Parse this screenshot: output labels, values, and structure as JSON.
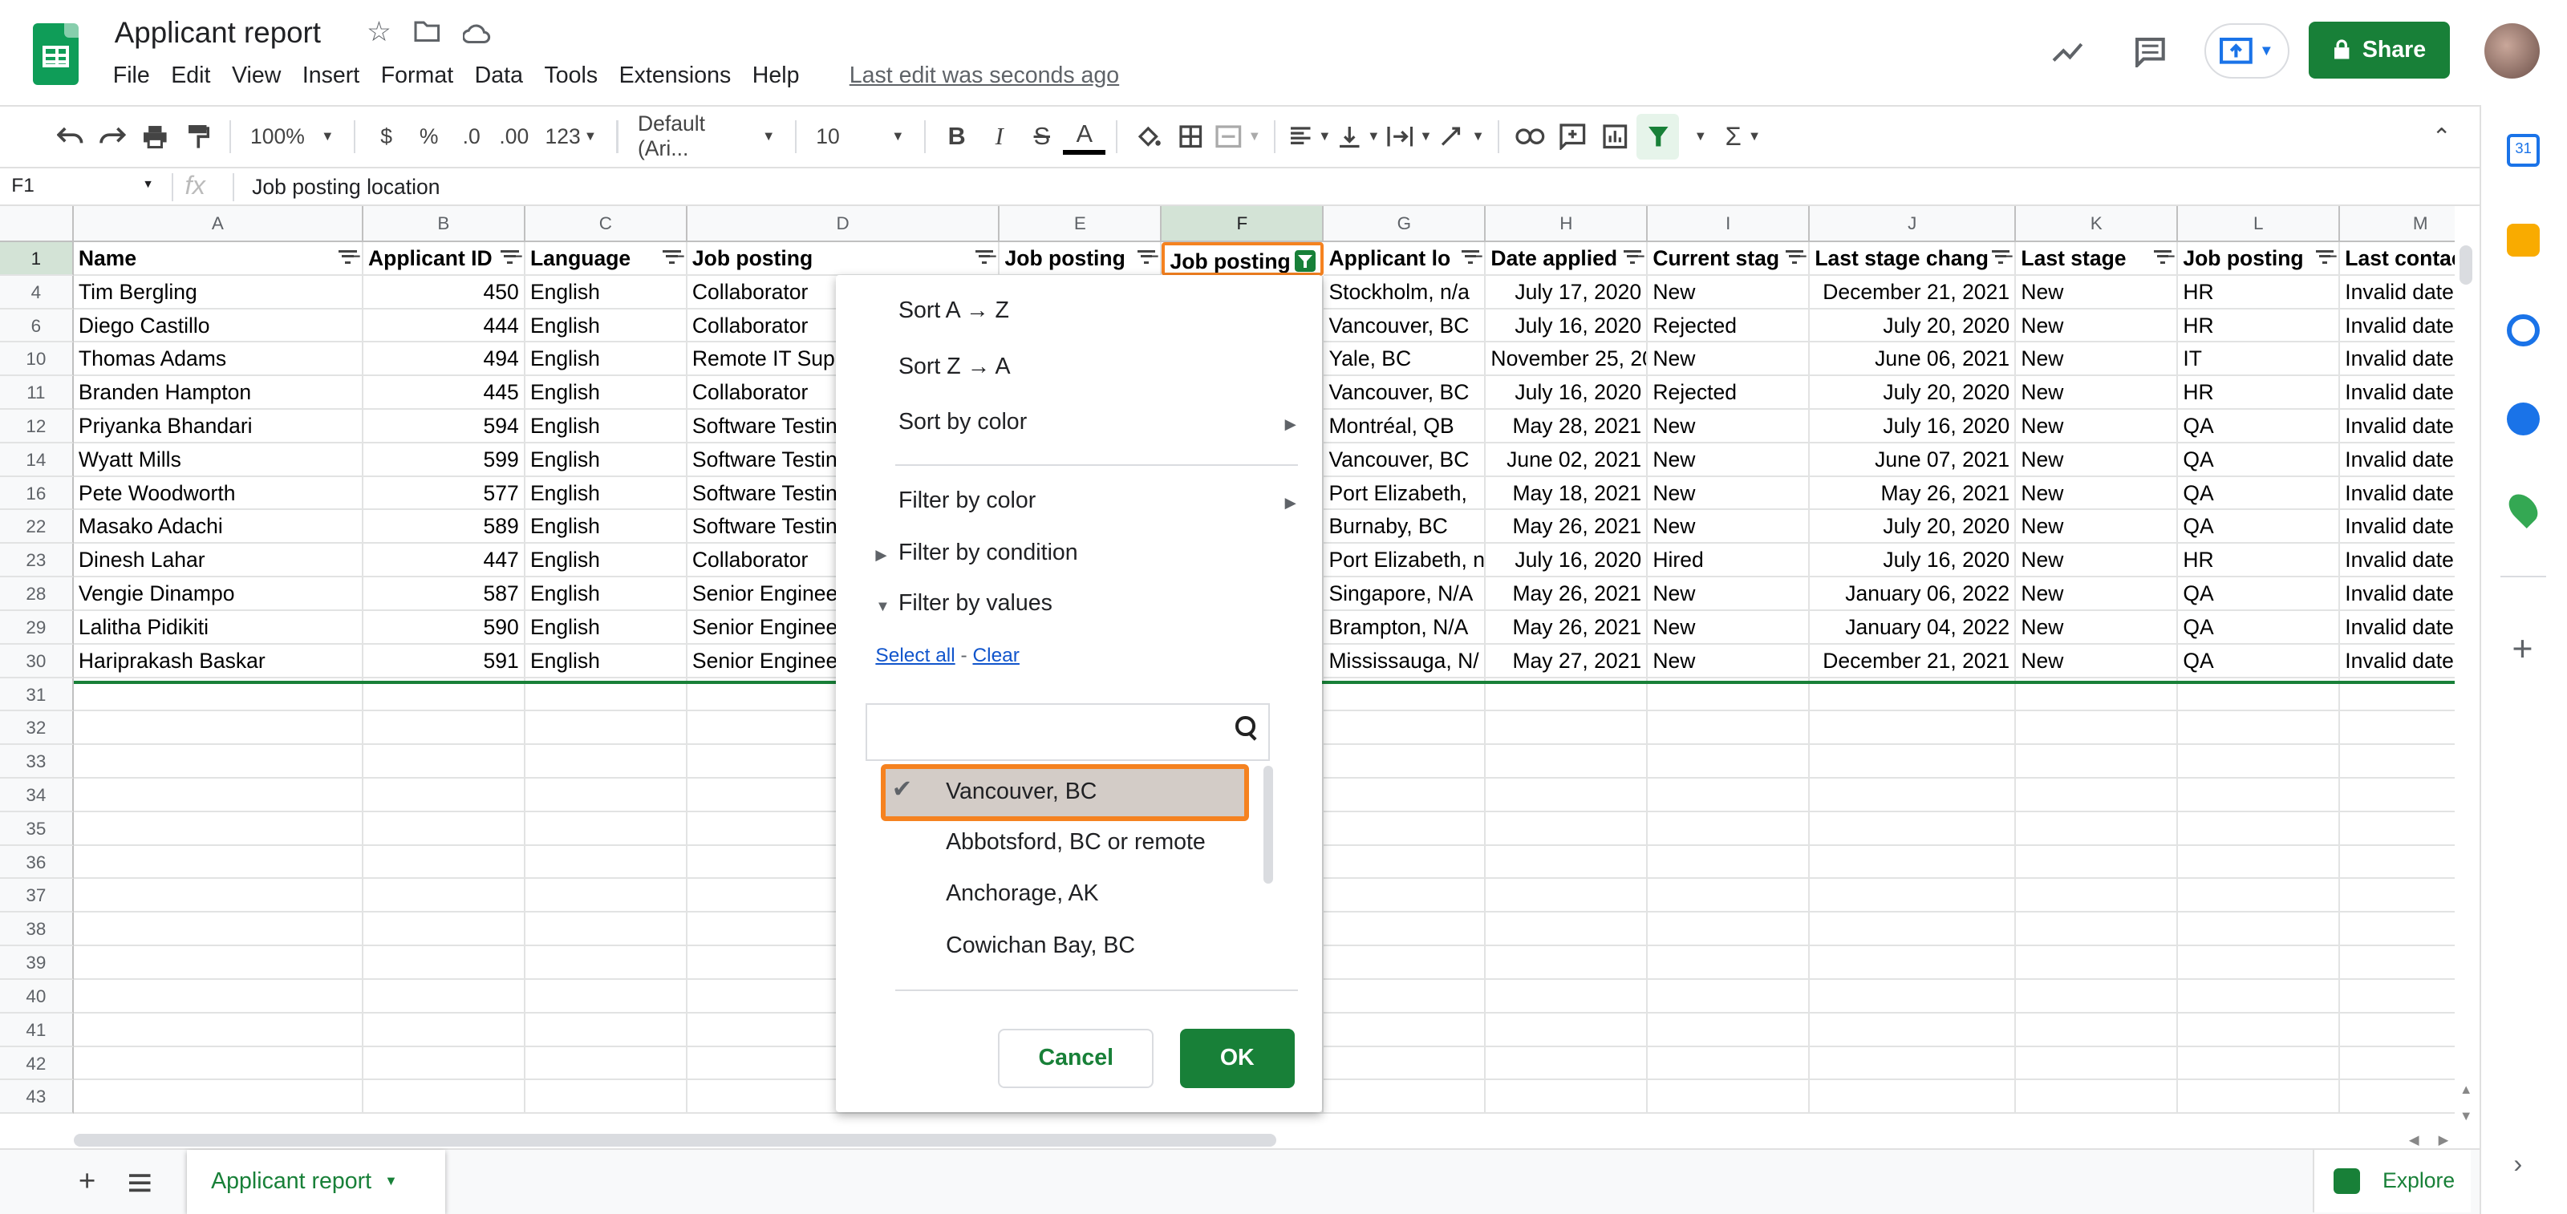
{
  "doc": {
    "title": "Applicant report",
    "last_edit": "Last edit was seconds ago"
  },
  "menu": [
    "File",
    "Edit",
    "View",
    "Insert",
    "Format",
    "Data",
    "Tools",
    "Extensions",
    "Help"
  ],
  "header": {
    "share_label": "Share"
  },
  "toolbar": {
    "zoom": "100%",
    "currency": "$",
    "percent": "%",
    "dec_less": ".0",
    "dec_more": ".00",
    "format_more": "123",
    "font": "Default (Ari...",
    "font_size": "10"
  },
  "formula_bar": {
    "cell_ref": "F1",
    "fx": "fx",
    "content": "Job posting location"
  },
  "columns": [
    "A",
    "B",
    "C",
    "D",
    "E",
    "F",
    "G",
    "H",
    "I",
    "J",
    "K",
    "L",
    "M"
  ],
  "header_row": {
    "row_num": "1",
    "cells": [
      "Name",
      "Applicant ID",
      "Language",
      "Job posting",
      "Job posting",
      "Job posting",
      "Applicant lo",
      "Date applied",
      "Current stag",
      "Last stage chang",
      "Last stage",
      "Job posting",
      "Last contac"
    ]
  },
  "rows": [
    {
      "num": "4",
      "cells": [
        "Tim Bergling",
        "450",
        "English",
        "Collaborator",
        "",
        "",
        "Stockholm, n/a",
        "July 17, 2020",
        "New",
        "December 21, 2021",
        "New",
        "HR",
        "Invalid date"
      ]
    },
    {
      "num": "6",
      "cells": [
        "Diego Castillo",
        "444",
        "English",
        "Collaborator",
        "",
        "",
        "Vancouver, BC",
        "July 16, 2020",
        "Rejected",
        "July 20, 2020",
        "New",
        "HR",
        "Invalid date"
      ]
    },
    {
      "num": "10",
      "cells": [
        "Thomas Adams",
        "494",
        "English",
        "Remote IT Sup",
        "",
        "",
        "Yale, BC",
        "November 25, 20",
        "New",
        "June 06, 2021",
        "New",
        "IT",
        "Invalid date"
      ]
    },
    {
      "num": "11",
      "cells": [
        "Branden Hampton",
        "445",
        "English",
        "Collaborator",
        "",
        "",
        "Vancouver, BC",
        "July 16, 2020",
        "Rejected",
        "July 20, 2020",
        "New",
        "HR",
        "Invalid date"
      ]
    },
    {
      "num": "12",
      "cells": [
        "Priyanka Bhandari",
        "594",
        "English",
        "Software Testin",
        "",
        "",
        "Montréal, QB",
        "May 28, 2021",
        "New",
        "July 16, 2020",
        "New",
        "QA",
        "Invalid date"
      ]
    },
    {
      "num": "14",
      "cells": [
        "Wyatt Mills",
        "599",
        "English",
        "Software Testin",
        "",
        "",
        "Vancouver, BC",
        "June 02, 2021",
        "New",
        "June 07, 2021",
        "New",
        "QA",
        "Invalid date"
      ]
    },
    {
      "num": "16",
      "cells": [
        "Pete Woodworth",
        "577",
        "English",
        "Software Testin",
        "",
        "",
        "Port Elizabeth,",
        "May 18, 2021",
        "New",
        "May 26, 2021",
        "New",
        "QA",
        "Invalid date"
      ]
    },
    {
      "num": "22",
      "cells": [
        "Masako Adachi",
        "589",
        "English",
        "Software Testin",
        "",
        "",
        "Burnaby, BC",
        "May 26, 2021",
        "New",
        "July 20, 2020",
        "New",
        "QA",
        "Invalid date"
      ]
    },
    {
      "num": "23",
      "cells": [
        "Dinesh Lahar",
        "447",
        "English",
        "Collaborator",
        "",
        "",
        "Port Elizabeth, n",
        "July 16, 2020",
        "Hired",
        "July 16, 2020",
        "New",
        "HR",
        "Invalid date"
      ]
    },
    {
      "num": "28",
      "cells": [
        "Vengie Dinampo",
        "587",
        "English",
        "Senior Enginee",
        "",
        "",
        "Singapore, N/A",
        "May 26, 2021",
        "New",
        "January 06, 2022",
        "New",
        "QA",
        "Invalid date"
      ]
    },
    {
      "num": "29",
      "cells": [
        "Lalitha Pidikiti",
        "590",
        "English",
        "Senior Enginee",
        "",
        "",
        "Brampton, N/A",
        "May 26, 2021",
        "New",
        "January 04, 2022",
        "New",
        "QA",
        "Invalid date"
      ]
    },
    {
      "num": "30",
      "cells": [
        "Hariprakash Baskar",
        "591",
        "English",
        "Senior Enginee",
        "",
        "",
        "Mississauga, N/",
        "May 27, 2021",
        "New",
        "December 21, 2021",
        "New",
        "QA",
        "Invalid date"
      ]
    }
  ],
  "empty_rows": [
    "31",
    "32",
    "33",
    "34",
    "35",
    "36",
    "37",
    "38",
    "39",
    "40",
    "41",
    "42",
    "43"
  ],
  "filter_menu": {
    "sort_az": "Sort A → Z",
    "sort_za": "Sort Z → A",
    "sort_color": "Sort by color",
    "filter_color": "Filter by color",
    "filter_condition": "Filter by condition",
    "filter_values": "Filter by values",
    "select_all": "Select all",
    "dash": "-",
    "clear": "Clear",
    "values": [
      {
        "label": "Vancouver, BC",
        "checked": true
      },
      {
        "label": "Abbotsford, BC or remote",
        "checked": false
      },
      {
        "label": "Anchorage, AK",
        "checked": false
      },
      {
        "label": "Cowichan Bay, BC",
        "checked": false
      }
    ],
    "cancel": "Cancel",
    "ok": "OK"
  },
  "sheet_tab": {
    "label": "Applicant report"
  },
  "explore": {
    "label": "Explore"
  },
  "colors": {
    "green": "#188038",
    "highlight": "#f58220",
    "selected_header": "#d3e3d6"
  }
}
